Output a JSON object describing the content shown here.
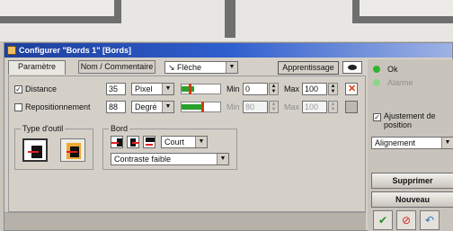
{
  "window": {
    "title": "Configurer \"Bords 1\" [Bords]"
  },
  "tabs": [
    {
      "label": "Paramètre",
      "active": true
    },
    {
      "label": "Nom / Commentaire",
      "active": false
    }
  ],
  "shape_dropdown": {
    "value": "Flèche"
  },
  "apprentissage_button": {
    "label": "Apprentissage"
  },
  "rows": {
    "distance": {
      "label": "Distance",
      "checked": true,
      "value": "35",
      "unit": "Pixel",
      "min_label": "Min",
      "min_value": "0",
      "max_label": "Max",
      "max_value": "100"
    },
    "repositionnement": {
      "label": "Repositionnement",
      "checked": false,
      "value": "88",
      "unit": "Degré",
      "min_label": "Min",
      "min_value": "80",
      "max_label": "Max",
      "max_value": "100"
    }
  },
  "type_outil": {
    "title": "Type d'outil"
  },
  "bord": {
    "title": "Bord",
    "length_value": "Court",
    "contrast_value": "Contraste faible"
  },
  "status_panel": {
    "ok": {
      "label": "Ok",
      "color": "#2fb52f"
    },
    "alarme": {
      "label": "Alarme",
      "color": "#8fd48f"
    }
  },
  "ajustement": {
    "label_line1": "Ajustement de",
    "label_line2": "position",
    "checked": true
  },
  "alignement": {
    "value": "Alignement"
  },
  "buttons": {
    "supprimer": "Supprimer",
    "nouveau": "Nouveau"
  },
  "icons": {
    "confirm": "✔",
    "cancel": "⃠",
    "undo": "↶"
  },
  "colors": {
    "title_bar": "#1d3f9c",
    "slider_fill": "#2aa12a",
    "accent_red": "#d43c10"
  }
}
